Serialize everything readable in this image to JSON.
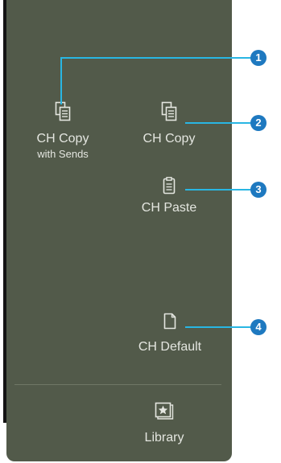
{
  "buttons": {
    "ch_copy_with_sends": {
      "line1": "CH Copy",
      "line2": "with Sends"
    },
    "ch_copy": {
      "label": "CH Copy"
    },
    "ch_paste": {
      "label": "CH Paste"
    },
    "ch_default": {
      "label": "CH Default"
    },
    "library": {
      "label": "Library"
    }
  },
  "callouts": [
    "1",
    "2",
    "3",
    "4"
  ],
  "colors": {
    "panel": "#525a4a",
    "text": "#e4e6e0",
    "callout_line": "#29b6e3",
    "callout_badge": "#1e79c0"
  }
}
